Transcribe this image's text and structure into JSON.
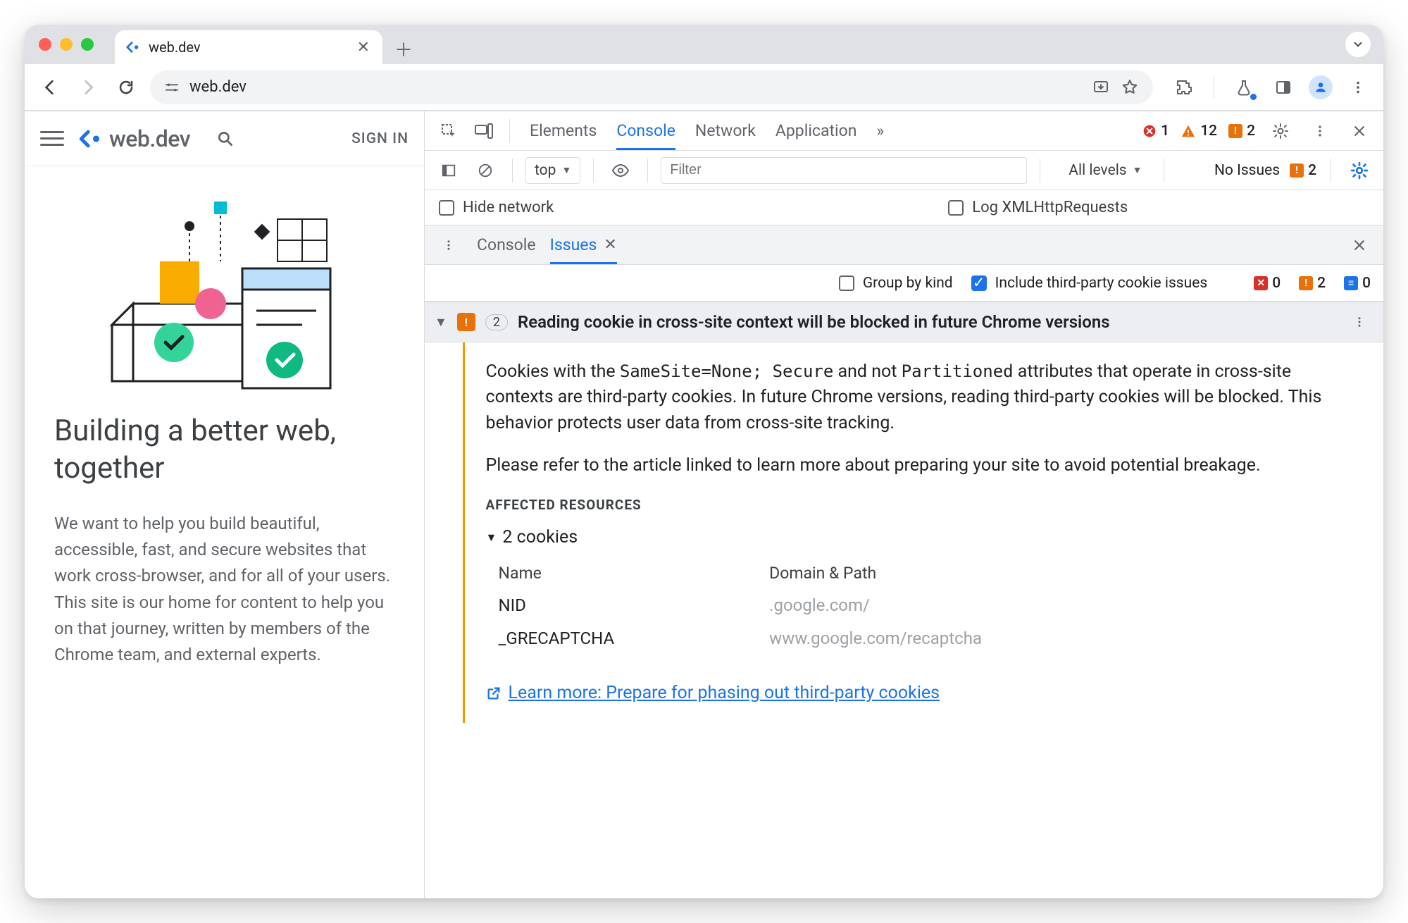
{
  "browser": {
    "tab_title": "web.dev",
    "url": "web.dev"
  },
  "page": {
    "brand": "web.dev",
    "sign_in": "SIGN IN",
    "heading": "Building a better web, together",
    "body": "We want to help you build beautiful, accessible, fast, and secure websites that work cross-browser, and for all of your users. This site is our home for content to help you on that journey, written by members of the Chrome team, and external experts."
  },
  "devtools": {
    "tabs": {
      "elements": "Elements",
      "console": "Console",
      "network": "Network",
      "application": "Application"
    },
    "counts": {
      "errors": "1",
      "warnings": "12",
      "issues": "2"
    },
    "filter": {
      "context": "top",
      "placeholder": "Filter",
      "levels": "All levels",
      "no_issues": "No Issues",
      "no_issues_count": "2"
    },
    "checks": {
      "hide_network": "Hide network",
      "log_xhr": "Log XMLHttpRequests"
    },
    "drawer": {
      "console": "Console",
      "issues": "Issues"
    },
    "issues_filter": {
      "group": "Group by kind",
      "include3p": "Include third-party cookie issues",
      "red": "0",
      "orange": "2",
      "blue": "0"
    },
    "issue": {
      "count": "2",
      "title": "Reading cookie in cross-site context will be blocked in future Chrome versions",
      "p1_a": "Cookies with the ",
      "p1_code": "SameSite=None; Secure",
      "p1_b": " and not ",
      "p1_code2": "Partitioned",
      "p1_c": " attributes that operate in cross-site contexts are third-party cookies. In future Chrome versions, reading third-party cookies will be blocked. This behavior protects user data from cross-site tracking.",
      "p2": "Please refer to the article linked to learn more about preparing your site to avoid potential breakage.",
      "affected": "AFFECTED RESOURCES",
      "cookies_label": "2 cookies",
      "th_name": "Name",
      "th_domain": "Domain & Path",
      "rows": [
        {
          "name": "NID",
          "domain": ".google.com/"
        },
        {
          "name": "_GRECAPTCHA",
          "domain": "www.google.com/recaptcha"
        }
      ],
      "learn": "Learn more: Prepare for phasing out third-party cookies"
    }
  }
}
